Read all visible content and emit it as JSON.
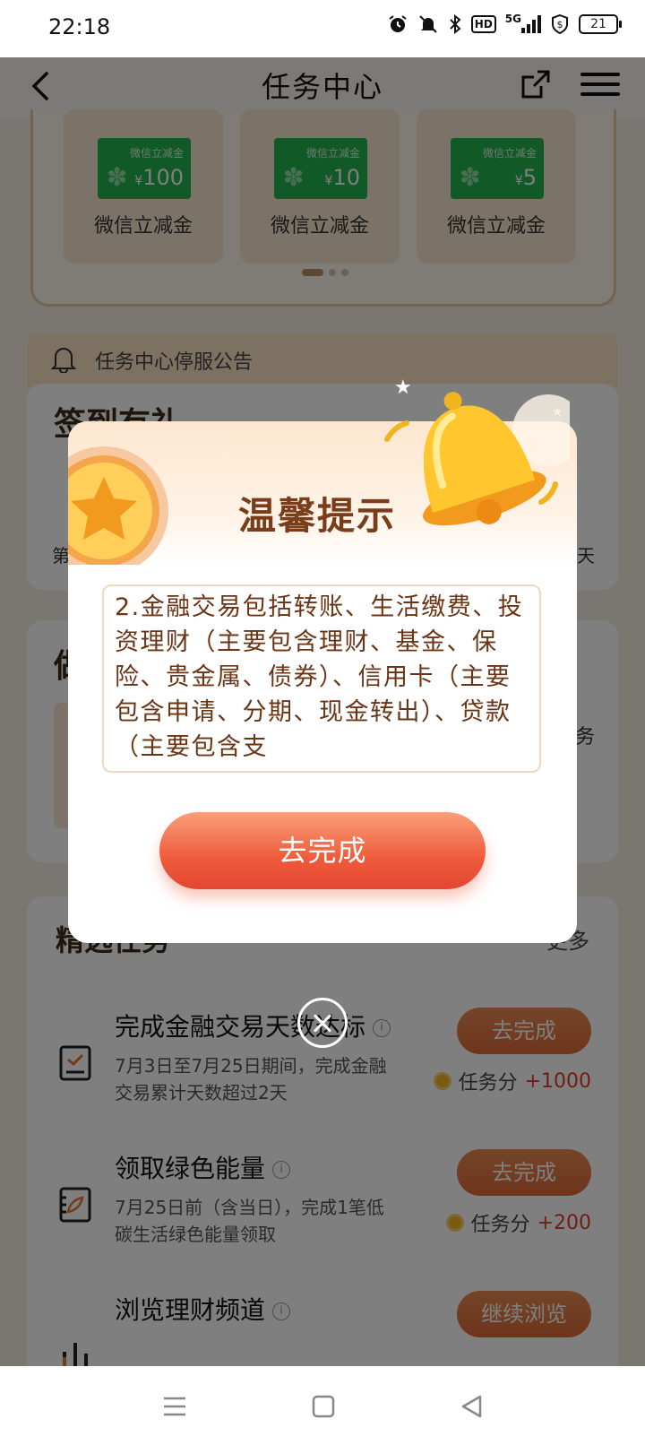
{
  "status_bar": {
    "time": "22:18",
    "hd": "HD",
    "network": "5G",
    "battery": "21"
  },
  "header": {
    "title": "任务中心"
  },
  "coupons": [
    {
      "caption": "微信立减金",
      "yen": "¥",
      "amount": "100",
      "name": "微信立减金"
    },
    {
      "caption": "微信立减金",
      "yen": "¥",
      "amount": "10",
      "name": "微信立减金"
    },
    {
      "caption": "微信立减金",
      "yen": "¥",
      "amount": "5",
      "name": "微信立减金"
    }
  ],
  "notice": {
    "text": "任务中心停服公告"
  },
  "signin": {
    "title": "签到有礼",
    "day_left": "第",
    "day_right": "天"
  },
  "wealth": {
    "title": "做",
    "side": "务"
  },
  "tasks": {
    "title": "精选任务",
    "more": "更多",
    "info_glyph": "i",
    "items": [
      {
        "name": "完成金融交易天数达标",
        "desc": "7月3日至7月25日期间，完成金融交易累计天数超过2天",
        "button": "去完成",
        "points_label": "任务分",
        "points": "+1000"
      },
      {
        "name": "领取绿色能量",
        "desc": "7月25日前（含当日），完成1笔低碳生活绿色能量领取",
        "button": "去完成",
        "points_label": "任务分",
        "points": "+200"
      },
      {
        "name": "浏览理财频道",
        "desc": "",
        "button": "继续浏览",
        "points_label": "",
        "points": ""
      }
    ]
  },
  "dialog": {
    "title": "温馨提示",
    "content": "2.金融交易包括转账、生活缴费、投资理财（主要包含理财、基金、保险、贵金属、债券）、信用卡（主要包含申请、分期、现金转出）、贷款（主要包含支",
    "button": "去完成"
  },
  "colors": {
    "accent": "#ef5b3b",
    "dialog_text": "#6b3515",
    "heading": "#7a3d1a",
    "wechat_green": "#22b24c"
  }
}
